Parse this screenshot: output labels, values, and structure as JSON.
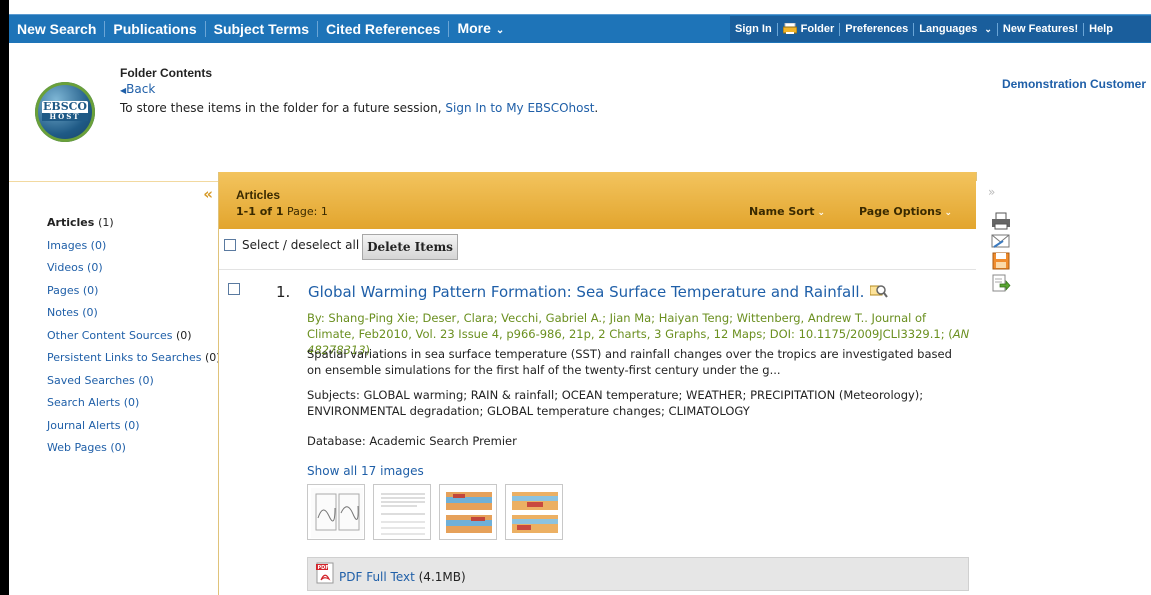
{
  "nav": {
    "left_items": [
      "New Search",
      "Publications",
      "Subject Terms",
      "Cited References",
      "More"
    ],
    "right_items": [
      "Sign In",
      "Folder",
      "Preferences",
      "Languages",
      "New Features!",
      "Help"
    ]
  },
  "header": {
    "logo_text": "EBSCO",
    "logo_sub": "HOST",
    "folder_title": "Folder Contents",
    "back_label": "Back",
    "store_text": "To store these items in the folder for a future session, ",
    "store_link": "Sign In to My EBSCOhost",
    "store_end": ".",
    "customer": "Demonstration Customer"
  },
  "sidebar": {
    "items": [
      {
        "label": "Articles",
        "count": "(1)",
        "active": true
      },
      {
        "label": "Images (0)"
      },
      {
        "label": "Videos (0)"
      },
      {
        "label": "Pages (0)"
      },
      {
        "label": "Notes (0)"
      },
      {
        "label": "Other Content Sources",
        "count": " (0)"
      },
      {
        "label": "Persistent Links to Searches",
        "count": " (0)"
      },
      {
        "label": "Saved Searches (0)"
      },
      {
        "label": "Search Alerts (0)"
      },
      {
        "label": "Journal Alerts (0)"
      },
      {
        "label": "Web Pages (0)"
      }
    ]
  },
  "main": {
    "section_title": "Articles",
    "range": "1-1 of 1",
    "page_label": "Page: 1",
    "sort_label": "Name Sort",
    "page_options_label": "Page Options",
    "select_all_label": "Select / deselect all",
    "delete_label": "Delete Items",
    "result": {
      "number": "1.",
      "title": "Global Warming Pattern Formation: Sea Surface Temperature and Rainfall.",
      "byline": "By: Shang-Ping Xie; Deser, Clara; Vecchi, Gabriel A.; Jian Ma; Haiyan Teng; Wittenberg, Andrew T.. Journal of Climate, Feb2010, Vol. 23 Issue 4, p966-986, 21p, 2 Charts, 3 Graphs, 12 Maps; DOI: 10.1175/2009JCLI3329.1; (",
      "an": "AN 48278313",
      "byline_end": ")",
      "abstract": "Spatial variations in sea surface temperature (SST) and rainfall changes over the tropics are investigated based on ensemble simulations for the first half of the twenty-first century under the g...",
      "subjects": "Subjects: GLOBAL warming; RAIN & rainfall; OCEAN temperature; WEATHER; PRECIPITATION (Meteorology); ENVIRONMENTAL degradation; GLOBAL temperature changes; CLIMATOLOGY",
      "database": "Database: Academic Search Premier",
      "show_images": "Show all 17 images",
      "pdf_label": "PDF Full Text",
      "pdf_size": "(4.1MB)"
    }
  },
  "colors": {
    "nav_blue": "#1e74b8",
    "link_blue": "#1f5fa8",
    "header_gold": "#e2a52e",
    "byline_green": "#6a8f1f"
  }
}
